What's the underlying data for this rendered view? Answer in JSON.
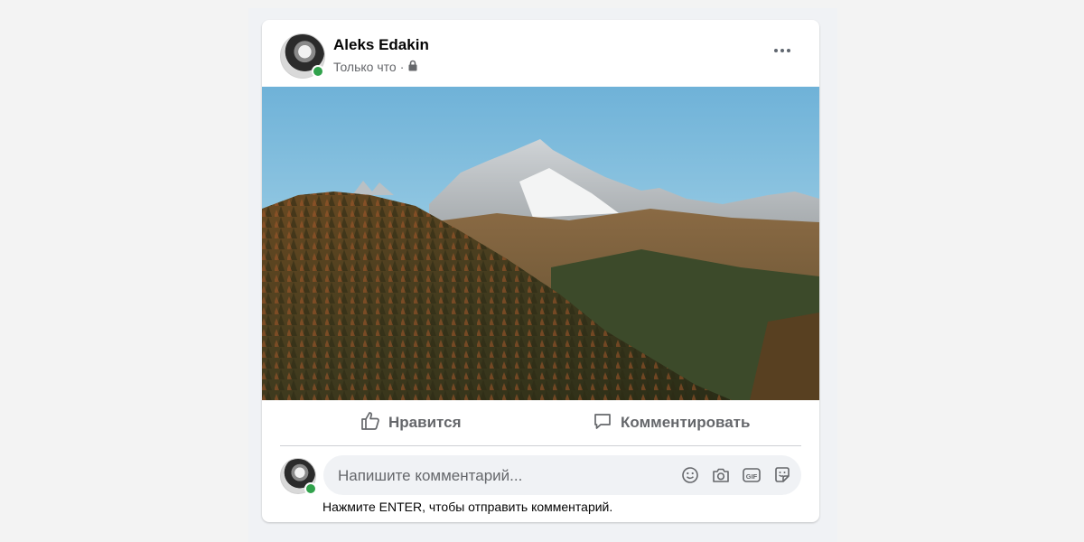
{
  "post": {
    "author": "Aleks Edakin",
    "timestamp": "Только что",
    "separator": "·",
    "privacy_icon": "lock-icon",
    "more_icon": "more-options-icon"
  },
  "actions": {
    "like_label": "Нравится",
    "comment_label": "Комментировать"
  },
  "comment": {
    "placeholder": "Напишите комментарий...",
    "hint": "Нажмите ENTER, чтобы отправить комментарий.",
    "icons": [
      "emoji-icon",
      "camera-icon",
      "gif-icon",
      "sticker-icon"
    ],
    "gif_text": "GIF"
  },
  "colors": {
    "online": "#31a24c",
    "secondary_text": "#65676b",
    "input_bg": "#f0f2f5"
  }
}
